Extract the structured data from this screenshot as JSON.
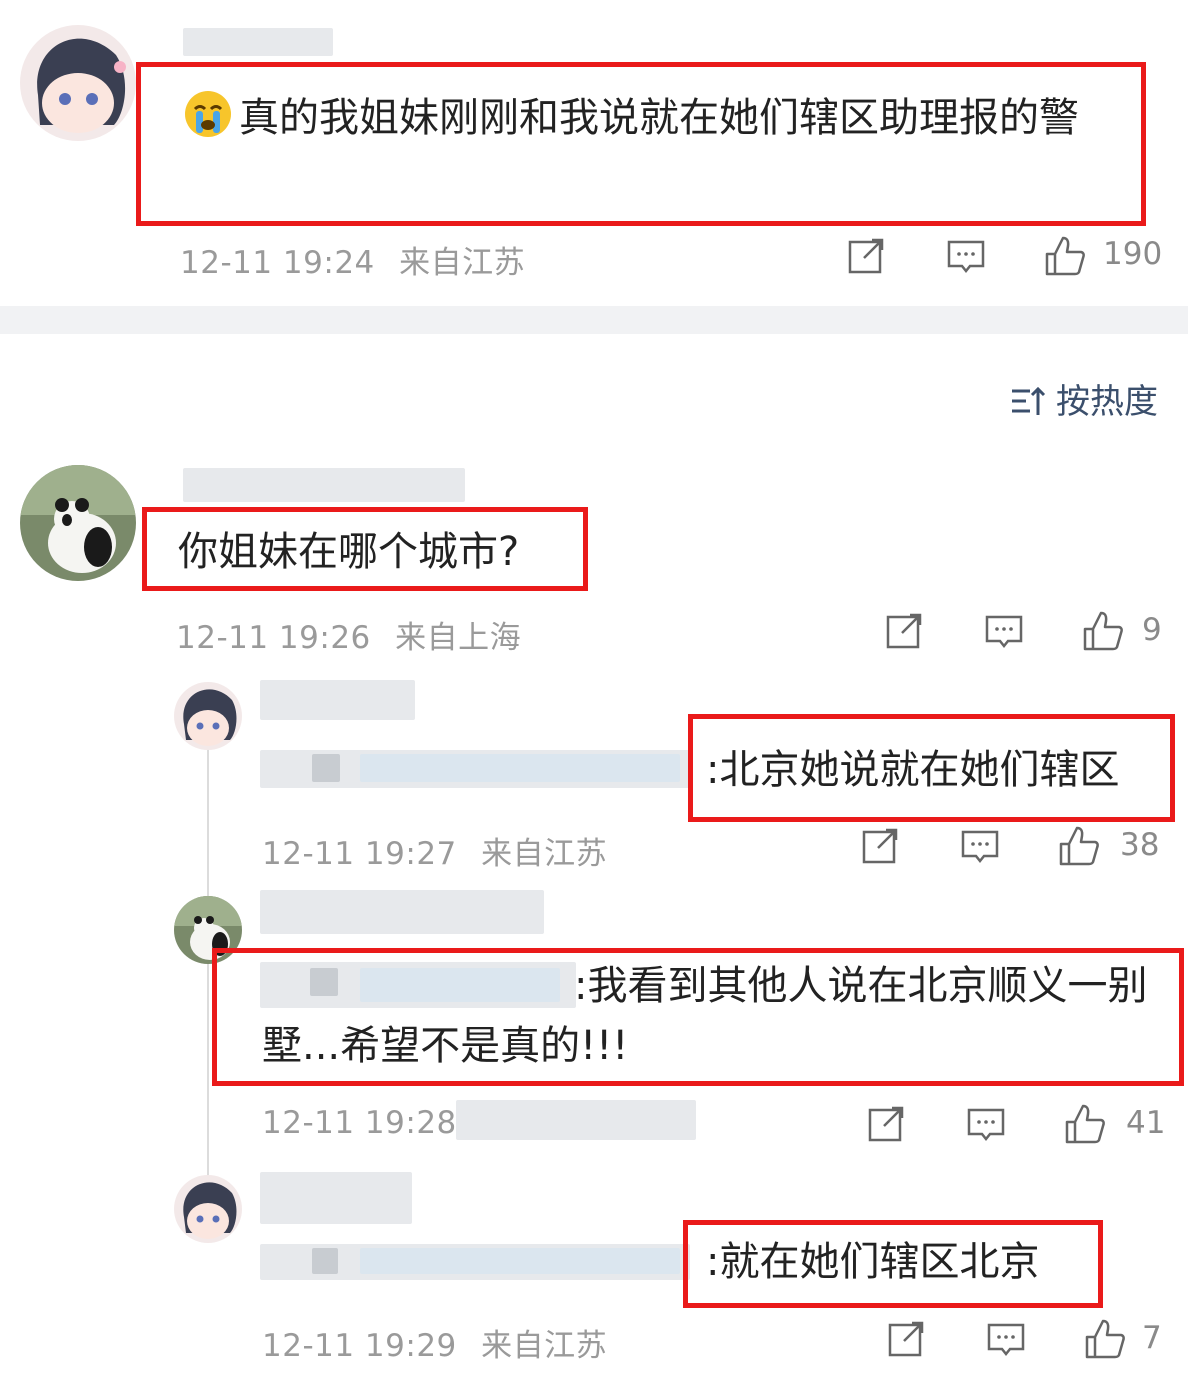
{
  "top_comment": {
    "emoji": "crying-face",
    "text": "真的我姐妹刚刚和我说就在她们辖区助理报的警",
    "time": "12-11 19:24",
    "location": "来自江苏",
    "likes": "190"
  },
  "sort": {
    "label": "按热度"
  },
  "comments": [
    {
      "text": "你姐妹在哪个城市?",
      "time": "12-11 19:26",
      "location": "来自上海",
      "likes": "9"
    }
  ],
  "replies": [
    {
      "text": ":北京她说就在她们辖区",
      "time": "12-11 19:27",
      "location": "来自江苏",
      "likes": "38"
    },
    {
      "text": ":我看到其他人说在北京顺义一别墅...希望不是真的!!!",
      "time": "12-11 19:28",
      "location": "",
      "likes": "41"
    },
    {
      "text": ":就在她们辖区北京",
      "time": "12-11 19:29",
      "location": "来自江苏",
      "likes": "7"
    }
  ],
  "colors": {
    "highlight": "#ea1a1a",
    "meta_gray": "#9a9a9a",
    "sort_blue": "#3b4f6c"
  }
}
